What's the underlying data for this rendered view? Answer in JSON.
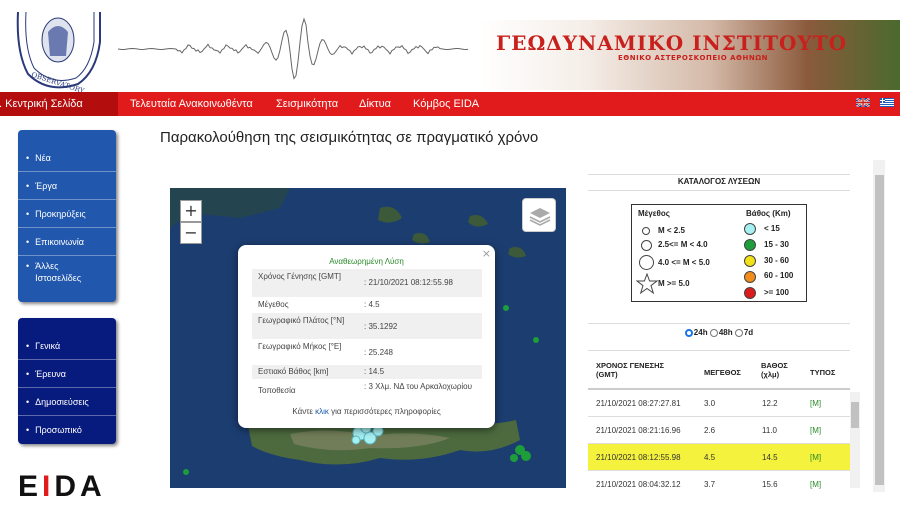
{
  "header": {
    "title": "ΓΕΩΔΥΝΑΜΙΚΟ ΙΝΣΤΙΤΟΥΤΟ",
    "subtitle": "ΕΘΝΙΚΟ ΑΣΤΕΡΟΣΚΟΠΕΙΟ ΑΘΗΝΩΝ"
  },
  "nav": {
    "items": [
      "Ι. Κεντρική Σελίδα",
      "Τελευταία Ανακοινωθέντα",
      "Σεισμικότητα",
      "Δίκτυα",
      "Κόμβος EIDA"
    ]
  },
  "sidebar": {
    "group1": [
      "Νέα",
      "Έργα",
      "Προκηρύξεις",
      "Επικοινωνία",
      "Άλλες Ιστοσελίδες"
    ],
    "group2": [
      "Γενικά",
      "Έρευνα",
      "Δημοσιεύσεις",
      "Προσωπικό"
    ]
  },
  "eida_logo": "EIDA",
  "page_title": "Παρακολούθηση της σεισμικότητας σε πραγματικό χρόνο",
  "map": {
    "zoom_in": "+",
    "zoom_out": "−",
    "popup": {
      "title": "Αναθεωρημένη Λύση",
      "close": "×",
      "rows": [
        {
          "label": "Χρόνος Γένησης [GMT]",
          "value": ": 21/10/2021 08:12:55.98"
        },
        {
          "label": "Μέγεθος",
          "value": ": 4.5"
        },
        {
          "label": "Γεωγραφικό Πλάτος [°N]",
          "value": ": 35.1292"
        },
        {
          "label": "Γεωγραφικό Μήκος [°E]",
          "value": ": 25.248"
        },
        {
          "label": "Εστιακό Βάθος [km]",
          "value": ": 14.5"
        },
        {
          "label": "Τοποθεσία",
          "value": ": 3 Χλμ. ΝΔ του Αρκαλοχωρίου"
        }
      ],
      "footer_pre": "Κάντε ",
      "footer_link": "κλικ",
      "footer_post": " για περισσότερες πληροφορίες"
    }
  },
  "catalog": {
    "title": "ΚΑΤΑΛΟΓΟΣ ΛΥΣΕΩΝ",
    "legend": {
      "mag_title": "Μέγεθος",
      "depth_title": "Βάθος (Km)",
      "mag_items": [
        "M < 2.5",
        "2.5<= M < 4.0",
        "4.0 <= M < 5.0",
        "M >= 5.0"
      ],
      "depth_items": [
        "< 15",
        "15 - 30",
        "30 - 60",
        "60 - 100",
        ">= 100"
      ],
      "depth_colors": [
        "#a6f0f2",
        "#1e9e3a",
        "#f2e019",
        "#f28c1a",
        "#d91c1c"
      ]
    },
    "radios": [
      "24h",
      "48h",
      "7d"
    ],
    "columns": [
      "ΧΡΟΝΟΣ ΓΕΝΕΣΗΣ (GMT)",
      "ΜΕΓΕΘΟΣ",
      "ΒΑΘΟΣ (χλμ)",
      "ΤΥΠΟΣ"
    ],
    "rows": [
      [
        "21/10/2021 08:27:27.81",
        "3.0",
        "12.2",
        "[M]"
      ],
      [
        "21/10/2021 08:21:16.96",
        "2.6",
        "11.0",
        "[M]"
      ],
      [
        "21/10/2021 08:12:55.98",
        "4.5",
        "14.5",
        "[M]"
      ],
      [
        "21/10/2021 08:04:32.12",
        "3.7",
        "15.6",
        "[M]"
      ]
    ],
    "highlight_color": "#f4f23c"
  }
}
